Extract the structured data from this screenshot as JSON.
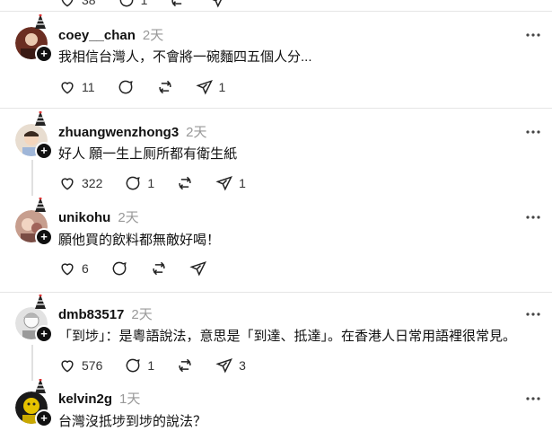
{
  "top_post": {
    "likes": "38",
    "replies": "1"
  },
  "posts": [
    {
      "username": "coey__chan",
      "timestamp": "2天",
      "text": "我相信台灣人，不會將一碗麵四五個人分...",
      "likes": "11",
      "replies": "",
      "reposts": "",
      "shares": "1",
      "avatar_color": "#7a3a2a"
    },
    {
      "username": "zhuangwenzhong3",
      "timestamp": "2天",
      "text": "好人 願一生上厠所都有衛生紙",
      "likes": "322",
      "replies": "1",
      "reposts": "",
      "shares": "1",
      "avatar_color": "#d9c8b0"
    },
    {
      "username": "unikohu",
      "timestamp": "2天",
      "text": "願他買的飲料都無敵好喝！",
      "likes": "6",
      "replies": "",
      "reposts": "",
      "shares": "",
      "avatar_color": "#b07a6e"
    },
    {
      "username": "dmb83517",
      "timestamp": "2天",
      "text": "「到埗」：是粵語說法，意思是「到達、抵達」。在香港人日常用語裡很常見。",
      "likes": "576",
      "replies": "1",
      "reposts": "",
      "shares": "3",
      "avatar_color": "#c8c8c8"
    },
    {
      "username": "kelvin2g",
      "timestamp": "1天",
      "text": "台灣沒抵埗到埗的說法？",
      "likes": "",
      "replies": "",
      "reposts": "",
      "shares": "",
      "avatar_color": "#d4b800"
    }
  ],
  "icons": {
    "like": "heart-icon",
    "reply": "comment-icon",
    "repost": "repost-icon",
    "share": "send-icon",
    "more": "more-icon",
    "follow": "plus-icon"
  },
  "colors": {
    "muted": "#999999",
    "divider": "#e5e5e5",
    "text": "#111111"
  }
}
